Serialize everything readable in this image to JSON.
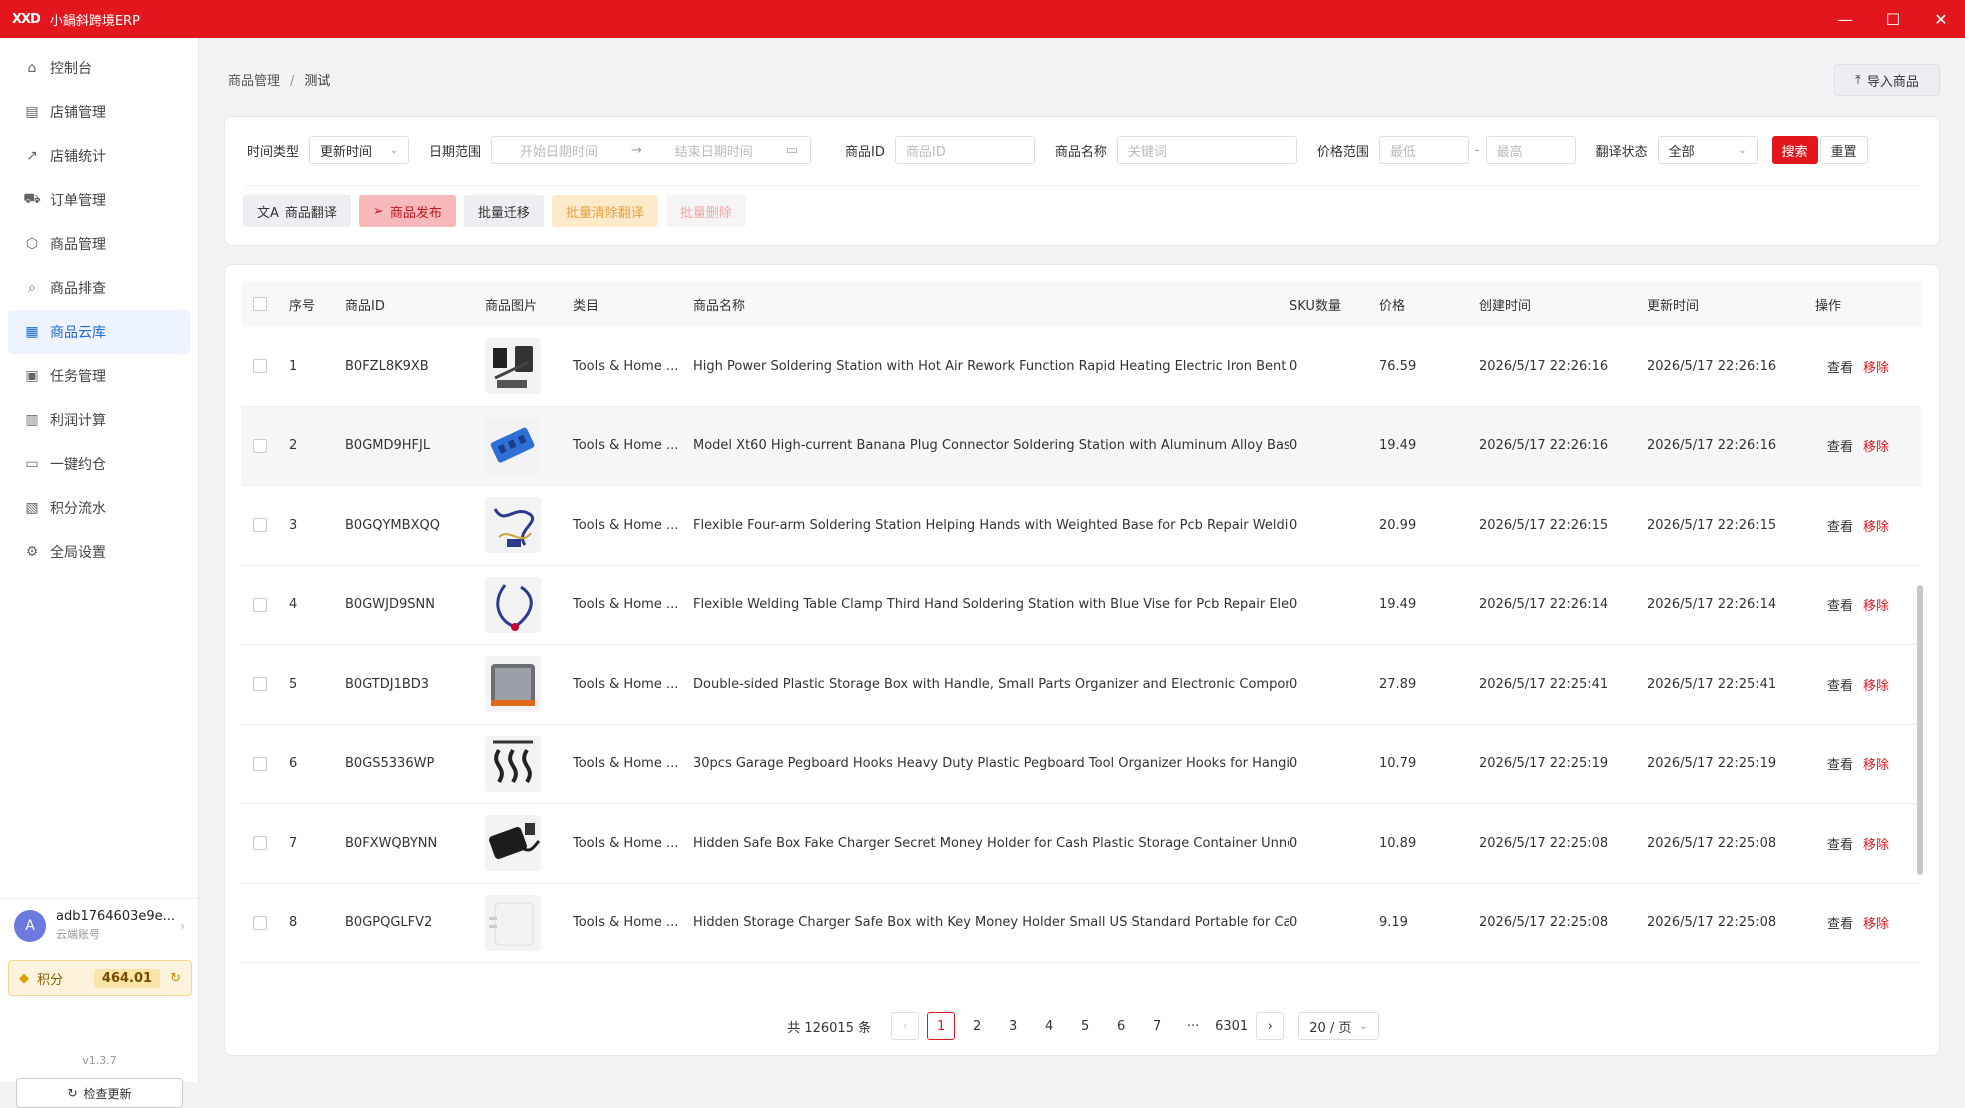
{
  "titlebar": {
    "logo": "XXD",
    "title": "小鍋斜跨境ERP",
    "minimize": "—",
    "maximize": "☐",
    "close": "✕"
  },
  "sidebar": {
    "items": [
      {
        "label": "控制台",
        "icon": "home-icon"
      },
      {
        "label": "店铺管理",
        "icon": "store-icon"
      },
      {
        "label": "店铺统计",
        "icon": "chart-icon"
      },
      {
        "label": "订单管理",
        "icon": "cart-icon"
      },
      {
        "label": "商品管理",
        "icon": "box-icon"
      },
      {
        "label": "商品排查",
        "icon": "search-icon"
      },
      {
        "label": "商品云库",
        "icon": "cloud-store-icon"
      },
      {
        "label": "任务管理",
        "icon": "clipboard-icon"
      },
      {
        "label": "利润计算",
        "icon": "calculator-icon"
      },
      {
        "label": "一键约仓",
        "icon": "calendar-icon"
      },
      {
        "label": "积分流水",
        "icon": "ledger-icon"
      },
      {
        "label": "全局设置",
        "icon": "gear-icon"
      }
    ],
    "active_index": 6,
    "user": {
      "avatar": "A",
      "name": "adb1764603e9e...",
      "sub": "云端账号"
    },
    "points": {
      "label": "积分",
      "value": "464.01"
    },
    "version": "v1.3.7",
    "check_update": "检查更新"
  },
  "breadcrumb": {
    "root": "商品管理",
    "sep": "/",
    "current": "测试"
  },
  "import_button": "导入商品",
  "filters": {
    "time_type_label": "时间类型",
    "time_type_value": "更新时间",
    "date_range_label": "日期范围",
    "date_start_placeholder": "开始日期时间",
    "date_end_placeholder": "结束日期时间",
    "product_id_label": "商品ID",
    "product_id_placeholder": "商品ID",
    "product_name_label": "商品名称",
    "product_name_placeholder": "关键词",
    "price_range_label": "价格范围",
    "price_min_placeholder": "最低",
    "price_max_placeholder": "最高",
    "price_sep": "-",
    "translate_status_label": "翻译状态",
    "translate_status_value": "全部",
    "search_button": "搜索",
    "reset_button": "重置"
  },
  "actions": {
    "translate": "商品翻译",
    "publish": "商品发布",
    "migrate": "批量迁移",
    "clear_translation": "批量清除翻译",
    "delete": "批量删除"
  },
  "table": {
    "headers": [
      "序号",
      "商品ID",
      "商品图片",
      "类目",
      "商品名称",
      "SKU数量",
      "价格",
      "创建时间",
      "更新时间",
      "操作"
    ],
    "view_label": "查看",
    "remove_label": "移除",
    "rows": [
      {
        "no": "1",
        "id": "B0FZL8K9XB",
        "category": "Tools & Home ...",
        "name": "High Power Soldering Station with Hot Air Rework Function Rapid Heating Electric Iron Bent T",
        "sku": "0",
        "price": "76.59",
        "created": "2026/5/17 22:26:16",
        "updated": "2026/5/17 22:26:16"
      },
      {
        "no": "2",
        "id": "B0GMD9HFJL",
        "category": "Tools & Home ...",
        "name": "Model Xt60 High-current Banana Plug Connector Soldering Station with Aluminum Alloy Base",
        "sku": "0",
        "price": "19.49",
        "created": "2026/5/17 22:26:16",
        "updated": "2026/5/17 22:26:16"
      },
      {
        "no": "3",
        "id": "B0GQYMBXQQ",
        "category": "Tools & Home ...",
        "name": "Flexible Four-arm Soldering Station Helping Hands with Weighted Base for Pcb Repair Weldin",
        "sku": "0",
        "price": "20.99",
        "created": "2026/5/17 22:26:15",
        "updated": "2026/5/17 22:26:15"
      },
      {
        "no": "4",
        "id": "B0GWJD9SNN",
        "category": "Tools & Home ...",
        "name": "Flexible Welding Table Clamp Third Hand Soldering Station with Blue Vise for Pcb Repair Electi",
        "sku": "0",
        "price": "19.49",
        "created": "2026/5/17 22:26:14",
        "updated": "2026/5/17 22:26:14"
      },
      {
        "no": "5",
        "id": "B0GTDJ1BD3",
        "category": "Tools & Home ...",
        "name": "Double-sided Plastic Storage Box with Handle, Small Parts Organizer and Electronic Compone",
        "sku": "0",
        "price": "27.89",
        "created": "2026/5/17 22:25:41",
        "updated": "2026/5/17 22:25:41"
      },
      {
        "no": "6",
        "id": "B0GS5336WP",
        "category": "Tools & Home ...",
        "name": "30pcs Garage Pegboard Hooks Heavy Duty Plastic Pegboard Tool Organizer Hooks for Hangin",
        "sku": "0",
        "price": "10.79",
        "created": "2026/5/17 22:25:19",
        "updated": "2026/5/17 22:25:19"
      },
      {
        "no": "7",
        "id": "B0FXWQBYNN",
        "category": "Tools & Home ...",
        "name": "Hidden Safe Box Fake Charger Secret Money Holder for Cash Plastic Storage Container Unnot",
        "sku": "0",
        "price": "10.89",
        "created": "2026/5/17 22:25:08",
        "updated": "2026/5/17 22:25:08"
      },
      {
        "no": "8",
        "id": "B0GPQGLFV2",
        "category": "Tools & Home ...",
        "name": "Hidden Storage Charger Safe Box with Key Money Holder Small US Standard Portable for Cash",
        "sku": "0",
        "price": "9.19",
        "created": "2026/5/17 22:25:08",
        "updated": "2026/5/17 22:25:08"
      }
    ]
  },
  "pagination": {
    "total": "共 126015 条",
    "prev": "‹",
    "next": "›",
    "pages": [
      "1",
      "2",
      "3",
      "4",
      "5",
      "6",
      "7",
      "···",
      "6301"
    ],
    "current": "1",
    "page_size": "20 / 页"
  },
  "colors": {
    "brand": "#e3161e",
    "active_bg": "#eef4ff",
    "active_text": "#1f6ad6"
  }
}
